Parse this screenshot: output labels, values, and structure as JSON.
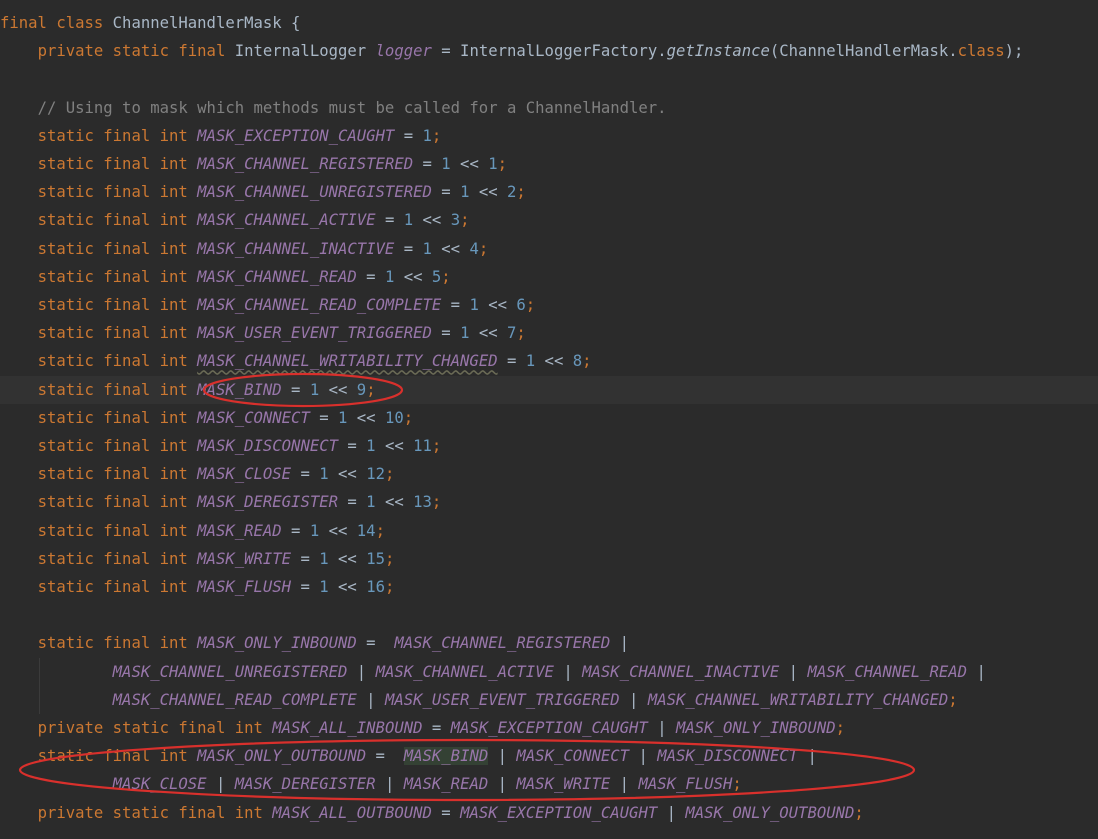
{
  "editor": {
    "lines": [
      {
        "tokens": [
          {
            "t": "kw",
            "v": "final class "
          },
          {
            "t": "txt",
            "v": "ChannelHandlerMask {"
          }
        ]
      },
      {
        "tokens": [
          {
            "t": "txt",
            "v": "    "
          },
          {
            "t": "kw",
            "v": "private static final "
          },
          {
            "t": "txt",
            "v": "InternalLogger "
          },
          {
            "t": "field",
            "v": "logger"
          },
          {
            "t": "txt",
            "v": " = InternalLoggerFactory."
          },
          {
            "t": "method",
            "v": "getInstance"
          },
          {
            "t": "txt",
            "v": "(ChannelHandlerMask."
          },
          {
            "t": "kw",
            "v": "class"
          },
          {
            "t": "txt",
            "v": ");"
          }
        ]
      },
      {
        "tokens": []
      },
      {
        "tokens": [
          {
            "t": "txt",
            "v": "    "
          },
          {
            "t": "comment",
            "v": "// Using to mask which methods must be called for a ChannelHandler."
          }
        ]
      },
      {
        "tokens": [
          {
            "t": "txt",
            "v": "    "
          },
          {
            "t": "kw",
            "v": "static final int "
          },
          {
            "t": "const",
            "v": "MASK_EXCEPTION_CAUGHT"
          },
          {
            "t": "txt",
            "v": " = "
          },
          {
            "t": "num",
            "v": "1"
          },
          {
            "t": "kw",
            "v": ";"
          }
        ]
      },
      {
        "tokens": [
          {
            "t": "txt",
            "v": "    "
          },
          {
            "t": "kw",
            "v": "static final int "
          },
          {
            "t": "const",
            "v": "MASK_CHANNEL_REGISTERED"
          },
          {
            "t": "txt",
            "v": " = "
          },
          {
            "t": "num",
            "v": "1"
          },
          {
            "t": "txt",
            "v": " << "
          },
          {
            "t": "num",
            "v": "1"
          },
          {
            "t": "kw",
            "v": ";"
          }
        ]
      },
      {
        "tokens": [
          {
            "t": "txt",
            "v": "    "
          },
          {
            "t": "kw",
            "v": "static final int "
          },
          {
            "t": "const",
            "v": "MASK_CHANNEL_UNREGISTERED"
          },
          {
            "t": "txt",
            "v": " = "
          },
          {
            "t": "num",
            "v": "1"
          },
          {
            "t": "txt",
            "v": " << "
          },
          {
            "t": "num",
            "v": "2"
          },
          {
            "t": "kw",
            "v": ";"
          }
        ]
      },
      {
        "tokens": [
          {
            "t": "txt",
            "v": "    "
          },
          {
            "t": "kw",
            "v": "static final int "
          },
          {
            "t": "const",
            "v": "MASK_CHANNEL_ACTIVE"
          },
          {
            "t": "txt",
            "v": " = "
          },
          {
            "t": "num",
            "v": "1"
          },
          {
            "t": "txt",
            "v": " << "
          },
          {
            "t": "num",
            "v": "3"
          },
          {
            "t": "kw",
            "v": ";"
          }
        ]
      },
      {
        "tokens": [
          {
            "t": "txt",
            "v": "    "
          },
          {
            "t": "kw",
            "v": "static final int "
          },
          {
            "t": "const",
            "v": "MASK_CHANNEL_INACTIVE"
          },
          {
            "t": "txt",
            "v": " = "
          },
          {
            "t": "num",
            "v": "1"
          },
          {
            "t": "txt",
            "v": " << "
          },
          {
            "t": "num",
            "v": "4"
          },
          {
            "t": "kw",
            "v": ";"
          }
        ]
      },
      {
        "tokens": [
          {
            "t": "txt",
            "v": "    "
          },
          {
            "t": "kw",
            "v": "static final int "
          },
          {
            "t": "const",
            "v": "MASK_CHANNEL_READ"
          },
          {
            "t": "txt",
            "v": " = "
          },
          {
            "t": "num",
            "v": "1"
          },
          {
            "t": "txt",
            "v": " << "
          },
          {
            "t": "num",
            "v": "5"
          },
          {
            "t": "kw",
            "v": ";"
          }
        ]
      },
      {
        "tokens": [
          {
            "t": "txt",
            "v": "    "
          },
          {
            "t": "kw",
            "v": "static final int "
          },
          {
            "t": "const",
            "v": "MASK_CHANNEL_READ_COMPLETE"
          },
          {
            "t": "txt",
            "v": " = "
          },
          {
            "t": "num",
            "v": "1"
          },
          {
            "t": "txt",
            "v": " << "
          },
          {
            "t": "num",
            "v": "6"
          },
          {
            "t": "kw",
            "v": ";"
          }
        ]
      },
      {
        "tokens": [
          {
            "t": "txt",
            "v": "    "
          },
          {
            "t": "kw",
            "v": "static final int "
          },
          {
            "t": "const",
            "v": "MASK_USER_EVENT_TRIGGERED"
          },
          {
            "t": "txt",
            "v": " = "
          },
          {
            "t": "num",
            "v": "1"
          },
          {
            "t": "txt",
            "v": " << "
          },
          {
            "t": "num",
            "v": "7"
          },
          {
            "t": "kw",
            "v": ";"
          }
        ]
      },
      {
        "tokens": [
          {
            "t": "txt",
            "v": "    "
          },
          {
            "t": "kw",
            "v": "static final int "
          },
          {
            "t": "const squiggle",
            "v": "MASK_CHANNEL_WRITABILITY_CHANGED"
          },
          {
            "t": "txt",
            "v": " = "
          },
          {
            "t": "num",
            "v": "1"
          },
          {
            "t": "txt",
            "v": " << "
          },
          {
            "t": "num",
            "v": "8"
          },
          {
            "t": "kw",
            "v": ";"
          }
        ]
      },
      {
        "current": true,
        "tokens": [
          {
            "t": "txt",
            "v": "    "
          },
          {
            "t": "kw",
            "v": "static final int "
          },
          {
            "t": "const",
            "v": "MASK_BIND"
          },
          {
            "t": "txt",
            "v": " = "
          },
          {
            "t": "num",
            "v": "1"
          },
          {
            "t": "txt",
            "v": " << "
          },
          {
            "t": "num",
            "v": "9"
          },
          {
            "t": "kw",
            "v": ";"
          }
        ]
      },
      {
        "tokens": [
          {
            "t": "txt",
            "v": "    "
          },
          {
            "t": "kw",
            "v": "static final int "
          },
          {
            "t": "const",
            "v": "MASK_CONNECT"
          },
          {
            "t": "txt",
            "v": " = "
          },
          {
            "t": "num",
            "v": "1"
          },
          {
            "t": "txt",
            "v": " << "
          },
          {
            "t": "num",
            "v": "10"
          },
          {
            "t": "kw",
            "v": ";"
          }
        ]
      },
      {
        "tokens": [
          {
            "t": "txt",
            "v": "    "
          },
          {
            "t": "kw",
            "v": "static final int "
          },
          {
            "t": "const",
            "v": "MASK_DISCONNECT"
          },
          {
            "t": "txt",
            "v": " = "
          },
          {
            "t": "num",
            "v": "1"
          },
          {
            "t": "txt",
            "v": " << "
          },
          {
            "t": "num",
            "v": "11"
          },
          {
            "t": "kw",
            "v": ";"
          }
        ]
      },
      {
        "tokens": [
          {
            "t": "txt",
            "v": "    "
          },
          {
            "t": "kw",
            "v": "static final int "
          },
          {
            "t": "const",
            "v": "MASK_CLOSE"
          },
          {
            "t": "txt",
            "v": " = "
          },
          {
            "t": "num",
            "v": "1"
          },
          {
            "t": "txt",
            "v": " << "
          },
          {
            "t": "num",
            "v": "12"
          },
          {
            "t": "kw",
            "v": ";"
          }
        ]
      },
      {
        "tokens": [
          {
            "t": "txt",
            "v": "    "
          },
          {
            "t": "kw",
            "v": "static final int "
          },
          {
            "t": "const",
            "v": "MASK_DEREGISTER"
          },
          {
            "t": "txt",
            "v": " = "
          },
          {
            "t": "num",
            "v": "1"
          },
          {
            "t": "txt",
            "v": " << "
          },
          {
            "t": "num",
            "v": "13"
          },
          {
            "t": "kw",
            "v": ";"
          }
        ]
      },
      {
        "tokens": [
          {
            "t": "txt",
            "v": "    "
          },
          {
            "t": "kw",
            "v": "static final int "
          },
          {
            "t": "const",
            "v": "MASK_READ"
          },
          {
            "t": "txt",
            "v": " = "
          },
          {
            "t": "num",
            "v": "1"
          },
          {
            "t": "txt",
            "v": " << "
          },
          {
            "t": "num",
            "v": "14"
          },
          {
            "t": "kw",
            "v": ";"
          }
        ]
      },
      {
        "tokens": [
          {
            "t": "txt",
            "v": "    "
          },
          {
            "t": "kw",
            "v": "static final int "
          },
          {
            "t": "const",
            "v": "MASK_WRITE"
          },
          {
            "t": "txt",
            "v": " = "
          },
          {
            "t": "num",
            "v": "1"
          },
          {
            "t": "txt",
            "v": " << "
          },
          {
            "t": "num",
            "v": "15"
          },
          {
            "t": "kw",
            "v": ";"
          }
        ]
      },
      {
        "tokens": [
          {
            "t": "txt",
            "v": "    "
          },
          {
            "t": "kw",
            "v": "static final int "
          },
          {
            "t": "const",
            "v": "MASK_FLUSH"
          },
          {
            "t": "txt",
            "v": " = "
          },
          {
            "t": "num",
            "v": "1"
          },
          {
            "t": "txt",
            "v": " << "
          },
          {
            "t": "num",
            "v": "16"
          },
          {
            "t": "kw",
            "v": ";"
          }
        ]
      },
      {
        "tokens": []
      },
      {
        "tokens": [
          {
            "t": "txt",
            "v": "    "
          },
          {
            "t": "kw",
            "v": "static final int "
          },
          {
            "t": "const",
            "v": "MASK_ONLY_INBOUND"
          },
          {
            "t": "txt",
            "v": " =  "
          },
          {
            "t": "const",
            "v": "MASK_CHANNEL_REGISTERED"
          },
          {
            "t": "txt",
            "v": " |"
          }
        ]
      },
      {
        "tokens": [
          {
            "t": "txt",
            "v": "            "
          },
          {
            "t": "const",
            "v": "MASK_CHANNEL_UNREGISTERED"
          },
          {
            "t": "txt",
            "v": " | "
          },
          {
            "t": "const",
            "v": "MASK_CHANNEL_ACTIVE"
          },
          {
            "t": "txt",
            "v": " | "
          },
          {
            "t": "const",
            "v": "MASK_CHANNEL_INACTIVE"
          },
          {
            "t": "txt",
            "v": " | "
          },
          {
            "t": "const",
            "v": "MASK_CHANNEL_READ"
          },
          {
            "t": "txt",
            "v": " |"
          }
        ]
      },
      {
        "tokens": [
          {
            "t": "txt",
            "v": "            "
          },
          {
            "t": "const",
            "v": "MASK_CHANNEL_READ_COMPLETE"
          },
          {
            "t": "txt",
            "v": " | "
          },
          {
            "t": "const",
            "v": "MASK_USER_EVENT_TRIGGERED"
          },
          {
            "t": "txt",
            "v": " | "
          },
          {
            "t": "const",
            "v": "MASK_CHANNEL_WRITABILITY_CHANGED"
          },
          {
            "t": "kw",
            "v": ";"
          }
        ]
      },
      {
        "tokens": [
          {
            "t": "txt",
            "v": "    "
          },
          {
            "t": "kw",
            "v": "private static final int "
          },
          {
            "t": "const",
            "v": "MASK_ALL_INBOUND"
          },
          {
            "t": "txt",
            "v": " = "
          },
          {
            "t": "const",
            "v": "MASK_EXCEPTION_CAUGHT"
          },
          {
            "t": "txt",
            "v": " | "
          },
          {
            "t": "const",
            "v": "MASK_ONLY_INBOUND"
          },
          {
            "t": "kw",
            "v": ";"
          }
        ]
      },
      {
        "tokens": [
          {
            "t": "txt",
            "v": "    "
          },
          {
            "t": "kw",
            "v": "static final int "
          },
          {
            "t": "const",
            "v": "MASK_ONLY_OUTBOUND"
          },
          {
            "t": "txt",
            "v": " =  "
          },
          {
            "t": "const hl-read",
            "v": "MASK_BIND"
          },
          {
            "t": "txt",
            "v": " | "
          },
          {
            "t": "const",
            "v": "MASK_CONNECT"
          },
          {
            "t": "txt",
            "v": " | "
          },
          {
            "t": "const",
            "v": "MASK_DISCONNECT"
          },
          {
            "t": "txt",
            "v": " |"
          }
        ]
      },
      {
        "tokens": [
          {
            "t": "txt",
            "v": "            "
          },
          {
            "t": "const",
            "v": "MASK_CLOSE"
          },
          {
            "t": "txt",
            "v": " | "
          },
          {
            "t": "const",
            "v": "MASK_DEREGISTER"
          },
          {
            "t": "txt",
            "v": " | "
          },
          {
            "t": "const",
            "v": "MASK_READ"
          },
          {
            "t": "txt",
            "v": " | "
          },
          {
            "t": "const",
            "v": "MASK_WRITE"
          },
          {
            "t": "txt",
            "v": " | "
          },
          {
            "t": "const",
            "v": "MASK_FLUSH"
          },
          {
            "t": "kw",
            "v": ";"
          }
        ]
      },
      {
        "tokens": [
          {
            "t": "txt",
            "v": "    "
          },
          {
            "t": "kw",
            "v": "private static final int "
          },
          {
            "t": "const",
            "v": "MASK_ALL_OUTBOUND"
          },
          {
            "t": "txt",
            "v": " = "
          },
          {
            "t": "const",
            "v": "MASK_EXCEPTION_CAUGHT"
          },
          {
            "t": "txt",
            "v": " | "
          },
          {
            "t": "const",
            "v": "MASK_ONLY_OUTBOUND"
          },
          {
            "t": "kw",
            "v": ";"
          }
        ]
      }
    ]
  },
  "colors": {
    "background": "#2b2b2b",
    "keyword": "#cc7832",
    "text": "#a9b7c6",
    "constant": "#9876aa",
    "number": "#6897bb",
    "comment": "#808080",
    "annotation": "#d9302c"
  }
}
